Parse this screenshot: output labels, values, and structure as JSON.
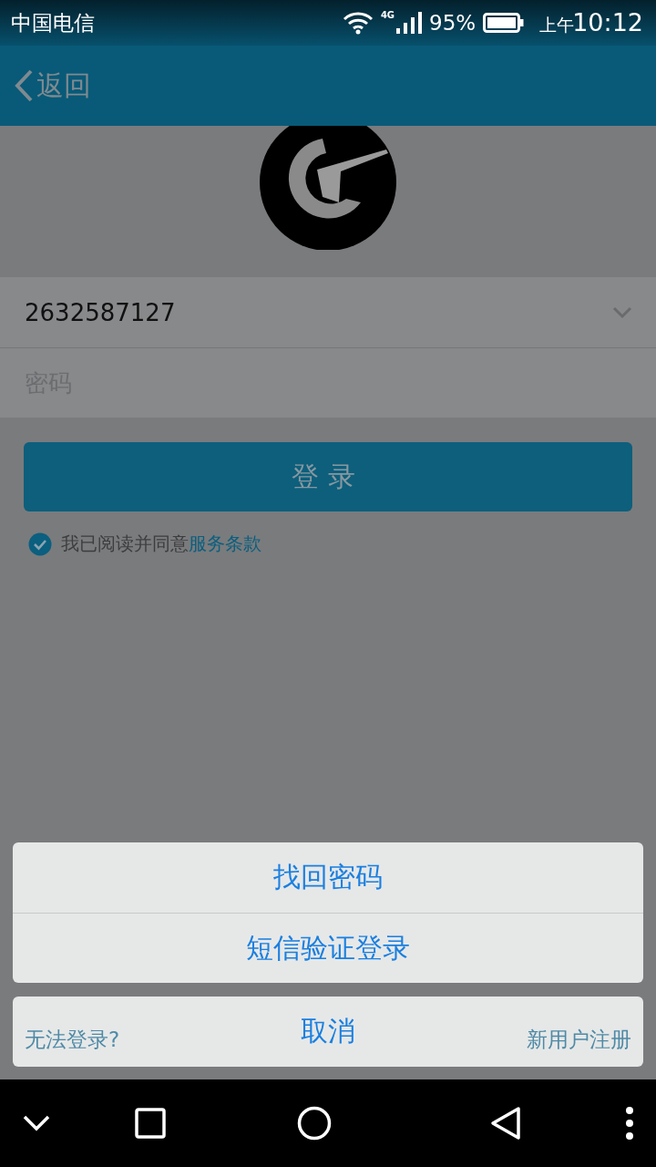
{
  "status_bar": {
    "carrier": "中国电信",
    "network": "4G",
    "battery": "95%",
    "time_prefix": "上午",
    "time": "10:12"
  },
  "header": {
    "back": "返回"
  },
  "login": {
    "account": "2632587127",
    "password_placeholder": "密码",
    "submit": "登录",
    "agreement": {
      "checked": true,
      "text": "我已阅读并同意",
      "link": "服务条款"
    },
    "links": {
      "trouble": "无法登录?",
      "register": "新用户注册"
    }
  },
  "action_sheet": {
    "options": [
      "找回密码",
      "短信验证登录"
    ],
    "cancel": "取消"
  }
}
